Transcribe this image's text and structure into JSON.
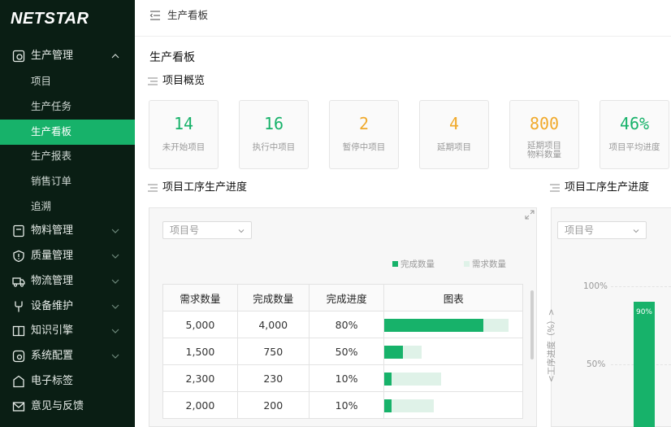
{
  "brand": {
    "logo": "NETSTAR",
    "accent": "#17b26a",
    "sidebar_bg": "#0a1e14"
  },
  "sidebar": {
    "groups": [
      {
        "label": "生产管理",
        "icon": "production-icon",
        "expanded": true
      },
      {
        "label": "物料管理",
        "icon": "material-icon"
      },
      {
        "label": "质量管理",
        "icon": "shield-icon"
      },
      {
        "label": "物流管理",
        "icon": "truck-icon"
      },
      {
        "label": "设备维护",
        "icon": "wrench-icon"
      },
      {
        "label": "知识引擎",
        "icon": "book-icon"
      },
      {
        "label": "系统配置",
        "icon": "settings-icon"
      },
      {
        "label": "电子标签",
        "icon": "tag-icon"
      },
      {
        "label": "意见与反馈",
        "icon": "mail-icon"
      }
    ],
    "sub_items": [
      "项目",
      "生产任务",
      "生产看板",
      "生产报表",
      "销售订单",
      "追溯"
    ],
    "active_sub": "生产看板"
  },
  "header": {
    "breadcrumb": "生产看板"
  },
  "page": {
    "title": "生产看板"
  },
  "overview": {
    "title": "项目概览",
    "cards": [
      {
        "value": "14",
        "label": "未开始项目",
        "color": "green"
      },
      {
        "value": "16",
        "label": "执行中项目",
        "color": "green"
      },
      {
        "value": "2",
        "label": "暂停中项目",
        "color": "orange"
      },
      {
        "value": "4",
        "label": "延期项目",
        "color": "orange"
      },
      {
        "value": "800",
        "label": "延期项目物料数量",
        "color": "orange"
      },
      {
        "value": "46%",
        "label": "项目平均进度",
        "color": "green"
      }
    ]
  },
  "progress_table": {
    "title": "项目工序生产进度",
    "select_placeholder": "项目号",
    "legend": {
      "done": "完成数量",
      "required": "需求数量"
    },
    "columns": [
      "需求数量",
      "完成数量",
      "完成进度",
      "图表"
    ],
    "rows": [
      {
        "required": "5,000",
        "done": "4,000",
        "pct": "80%",
        "ratio": 0.8
      },
      {
        "required": "1,500",
        "done": "750",
        "pct": "50%",
        "ratio": 0.5
      },
      {
        "required": "2,300",
        "done": "230",
        "pct": "10%",
        "ratio": 0.1
      },
      {
        "required": "2,000",
        "done": "200",
        "pct": "10%",
        "ratio": 0.1
      }
    ]
  },
  "progress_chart": {
    "title": "项目工序生产进度",
    "select_placeholder": "项目号",
    "ylabel": "<工序进度（%）>",
    "ticks": [
      "100%",
      "50%"
    ],
    "bars": [
      {
        "value": 0.9,
        "label": "90%"
      }
    ]
  }
}
